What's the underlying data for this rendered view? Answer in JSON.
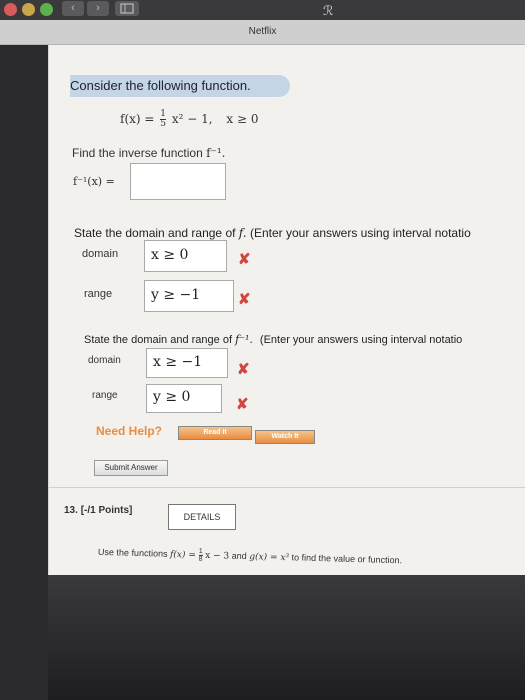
{
  "window": {
    "tab_title": "Netflix",
    "toolbar": {
      "back_label": "‹",
      "forward_label": "›"
    }
  },
  "question": {
    "prompt_title": "Consider the following function.",
    "function": {
      "f": "f(x) =",
      "num": "1",
      "den": "5",
      "rest": "x² − 1,",
      "cond": "x ≥ 0"
    },
    "inverse_prompt": "Find the inverse function",
    "inverse_symbol": "f⁻¹.",
    "inverse_label": "f⁻¹(x) =",
    "inverse_value": "",
    "domain_range_prompt_f": "State the domain and range of",
    "f_symbol": "f.",
    "enter_note": "(Enter your answers using interval notatio",
    "f_domain_label": "domain",
    "f_domain_value": "x ≥ 0",
    "f_range_label": "range",
    "f_range_value": "y ≥ −1",
    "domain_range_prompt_inv": "State the domain and range of",
    "inv_symbol": "f⁻¹.",
    "enter_note_inv": "(Enter your answers using interval notatio",
    "inv_domain_label": "domain",
    "inv_domain_value": "x ≥ −1",
    "inv_range_label": "range",
    "inv_range_value": "y ≥ 0",
    "wrong_mark": "✘",
    "need_help": "Need Help?",
    "read_it": "Read It",
    "watch_it": "Watch It",
    "submit": "Submit Answer"
  },
  "next_question": {
    "number": "13.",
    "points": "[-/1 Points]",
    "details": "DETAILS",
    "text_start": "Use the functions",
    "f_def": "f(x) = ",
    "f_num": "1",
    "f_den": "8",
    "f_rest": "x − 3",
    "and": "and",
    "g_def": "g(x) = x³",
    "text_end": "to find the value or function."
  },
  "colors": {
    "accent_pill": "#c4d5e6",
    "error_red": "#d0473f",
    "help_orange": "#e98d42"
  }
}
